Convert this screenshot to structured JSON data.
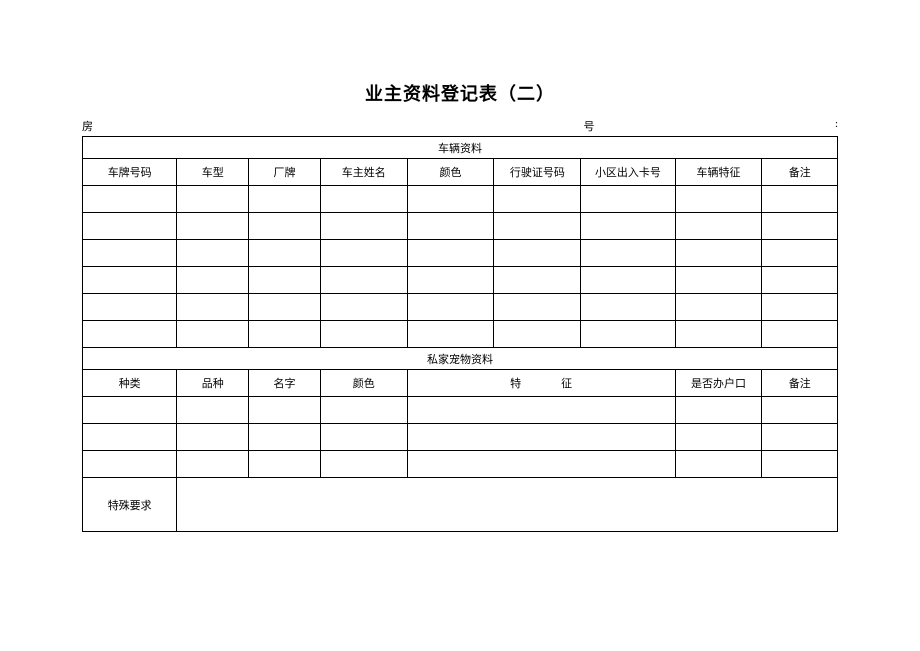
{
  "title": "业主资料登记表（二）",
  "header": {
    "fang": "房",
    "hao": "号",
    "colon": ":"
  },
  "section1": {
    "title": "车辆资料",
    "headers": [
      "车牌号码",
      "车型",
      "厂牌",
      "车主姓名",
      "颜色",
      "行驶证号码",
      "小区出入卡号",
      "车辆特征",
      "备注"
    ]
  },
  "section2": {
    "title": "私家宠物资料",
    "headers": {
      "zhonglei": "种类",
      "pinzhong": "品种",
      "mingzi": "名字",
      "yanse": "颜色",
      "te": "特",
      "zheng": "征",
      "shifou": "是否办户口",
      "beizhu": "备注"
    }
  },
  "special_req": "特殊要求"
}
